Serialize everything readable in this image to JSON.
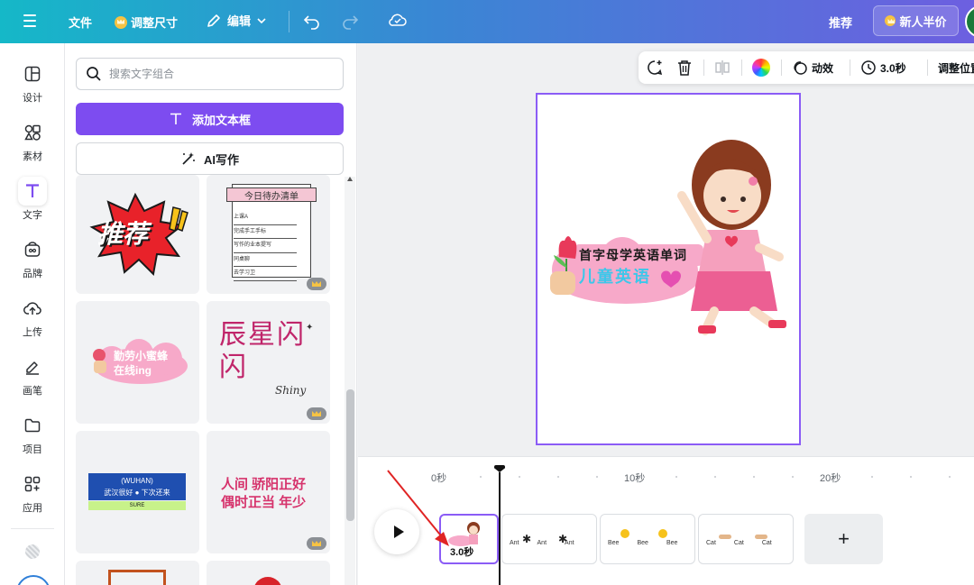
{
  "topbar": {
    "file": "文件",
    "resize": "调整尺寸",
    "edit": "编辑",
    "recommend": "推荐",
    "promo": "新人半价"
  },
  "rail": {
    "items": [
      {
        "label": "设计",
        "icon": "layout-icon"
      },
      {
        "label": "素材",
        "icon": "elements-icon"
      },
      {
        "label": "文字",
        "icon": "text-icon"
      },
      {
        "label": "品牌",
        "icon": "brand-icon"
      },
      {
        "label": "上传",
        "icon": "upload-icon"
      },
      {
        "label": "画笔",
        "icon": "brush-icon"
      },
      {
        "label": "项目",
        "icon": "folder-icon"
      },
      {
        "label": "应用",
        "icon": "apps-icon"
      }
    ]
  },
  "panel": {
    "search_placeholder": "搜索文字组合",
    "add_textbox": "添加文本框",
    "ai_write": "AI写作",
    "tiles": [
      {
        "text": "推荐"
      },
      {
        "title": "今日待办清单",
        "lines": [
          "上课A",
          "完成手工手标",
          "写作的业本提写",
          "同桌聊",
          "去学习卫"
        ]
      },
      {
        "line1": "勤劳小蜜蜂",
        "line2": "在线ing"
      },
      {
        "title": "辰星闪闪",
        "sub": "Shiny"
      },
      {
        "line1": "(WUHAN)",
        "line2": "武汉很好 ● 下次还来",
        "line3": "SURE"
      },
      {
        "line1": "人间 骄阳正好",
        "line2": "偶时正当 年少"
      }
    ]
  },
  "context_toolbar": {
    "animate": "动效",
    "duration": "3.0秒",
    "position": "调整位置"
  },
  "canvas": {
    "sticker_line1": "首字母学英语单词",
    "sticker_line2": "儿童英语"
  },
  "timeline": {
    "ticks": [
      "0秒",
      "10秒",
      "20秒"
    ],
    "clips": [
      {
        "duration": "3.0秒",
        "selected": true,
        "words": []
      },
      {
        "duration": "",
        "selected": false,
        "words": [
          "Ant",
          "Ant",
          "Ant"
        ]
      },
      {
        "duration": "",
        "selected": false,
        "words": [
          "Bee",
          "Bee",
          "Bee"
        ]
      },
      {
        "duration": "",
        "selected": false,
        "words": [
          "Cat",
          "Cat",
          "Cat"
        ]
      }
    ]
  },
  "colors": {
    "accent": "#7d4cf0",
    "selection": "#8b5cf6",
    "annotation_arrow": "#e02424"
  }
}
